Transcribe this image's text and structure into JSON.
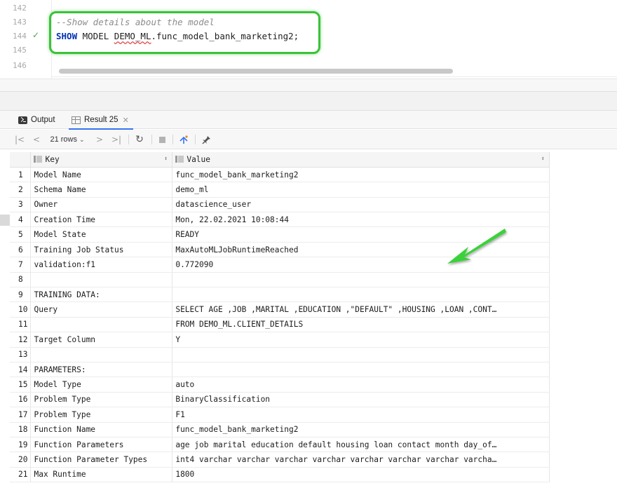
{
  "editor": {
    "lines": [
      {
        "num": "142"
      },
      {
        "num": "143",
        "comment": "--Show details about the model"
      },
      {
        "num": "144",
        "kw": "SHOW",
        "text_a": " MODEL ",
        "err": "DEMO_ML",
        "text_b": ".func_model_bank_marketing2;",
        "status": "success-check-icon"
      },
      {
        "num": "145"
      },
      {
        "num": "146"
      }
    ],
    "highlight_color": "#3bc23a"
  },
  "tabs": [
    {
      "label": "Output",
      "icon": "console-output-icon"
    },
    {
      "label": "Result 25",
      "icon": "table-grid-icon",
      "active": true
    }
  ],
  "toolbar": {
    "rows_label": "21 rows",
    "first": "|<",
    "prev": "<",
    "next": ">",
    "last": ">|",
    "refresh": "↻",
    "pin": "📌"
  },
  "grid": {
    "columns": [
      "Key",
      "Value"
    ],
    "rows": [
      {
        "n": "1",
        "key": "Model Name",
        "value": "func_model_bank_marketing2"
      },
      {
        "n": "2",
        "key": "Schema Name",
        "value": "demo_ml"
      },
      {
        "n": "3",
        "key": "Owner",
        "value": "datascience_user"
      },
      {
        "n": "4",
        "key": "Creation Time",
        "value": "Mon, 22.02.2021 10:08:44"
      },
      {
        "n": "5",
        "key": "Model State",
        "value": "READY"
      },
      {
        "n": "6",
        "key": "Training Job Status",
        "value": "MaxAutoMLJobRuntimeReached"
      },
      {
        "n": "7",
        "key": "validation:f1",
        "value": "0.772090"
      },
      {
        "n": "8",
        "key": "",
        "value": ""
      },
      {
        "n": "9",
        "key": "TRAINING DATA:",
        "value": ""
      },
      {
        "n": "10",
        "key": "Query",
        "value": "SELECT AGE ,JOB ,MARITAL ,EDUCATION ,\"DEFAULT\" ,HOUSING ,LOAN ,CONT…"
      },
      {
        "n": "11",
        "key": "",
        "value": "FROM DEMO_ML.CLIENT_DETAILS"
      },
      {
        "n": "12",
        "key": "Target Column",
        "value": "Y"
      },
      {
        "n": "13",
        "key": "",
        "value": ""
      },
      {
        "n": "14",
        "key": "PARAMETERS:",
        "value": ""
      },
      {
        "n": "15",
        "key": "Model Type",
        "value": "auto"
      },
      {
        "n": "16",
        "key": "Problem Type",
        "value": "BinaryClassification"
      },
      {
        "n": "17",
        "key": "Problem Type",
        "value": "F1"
      },
      {
        "n": "18",
        "key": "Function Name",
        "value": "func_model_bank_marketing2"
      },
      {
        "n": "19",
        "key": "Function Parameters",
        "value": "age job marital education default housing loan contact month day_of…"
      },
      {
        "n": "20",
        "key": "Function Parameter Types",
        "value": "int4 varchar varchar varchar varchar varchar varchar varchar varcha…"
      },
      {
        "n": "21",
        "key": "Max Runtime",
        "value": "1800"
      }
    ]
  },
  "annotation_arrow_color": "#3bd13a"
}
